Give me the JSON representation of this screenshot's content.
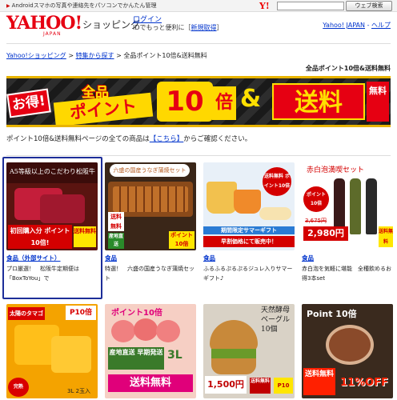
{
  "topbar": {
    "notice": "Androidスマホの写真や連絡先をパソコンでかんたん管理",
    "search_button": "ウェブ検索",
    "search_placeholder": "",
    "y_logo": "Y!"
  },
  "header": {
    "logo": "YAHOO!",
    "logo_sub": "JAPAN",
    "site_name": "ショッピング",
    "login": "ログイン",
    "login_sub": "IDでもっと便利に",
    "register": "新規取得",
    "yahoo_japan_link": "Yahoo! JAPAN",
    "separator": "-",
    "help_link": "ヘルプ"
  },
  "breadcrumb": {
    "items": [
      "Yahoo!ショッピング",
      "特集から探す"
    ],
    "current": "全品ポイント10倍&送料無料",
    "sep": ">"
  },
  "page_title": "全品ポイント10倍&送料無料",
  "banner": {
    "otoku": "お得!",
    "zenpin": "全品",
    "point": "ポイント",
    "ten": "10",
    "bai": "倍",
    "amp": "&",
    "soryo": "送料",
    "muryo": "無料"
  },
  "description": {
    "before": "ポイント10倍&送料無料ページの全ての商品は",
    "link": "【こちら】",
    "after": "からご確認ください。"
  },
  "products": [
    {
      "category": "食品（外部サイト）",
      "title": "プロ厳選！　松阪牛定期便は「BoxToYou」で",
      "img_caption": "A5等級以上のこだわり松阪牛",
      "img_badge": "初回購入分 ポイント10倍!",
      "img_badge2": "送料無料",
      "colors": {
        "bg": "#5a1410",
        "accent": "#c41e3a"
      }
    },
    {
      "category": "食品",
      "title": "特選！　六盛の国産うなぎ蒲焼セット",
      "img_caption": "六盛の国産うなぎ蒲焼セット",
      "img_badge": "産地直送",
      "img_badge2": "送料無料",
      "img_badge3": "ポイント10倍",
      "colors": {
        "bg": "#3a2618",
        "accent": "#b55a1f"
      }
    },
    {
      "category": "食品",
      "title": "ふるふるぷるぷるジュレ入りサマーギフト♪",
      "img_caption": "期間限定サマーギフト",
      "img_badge": "早割価格にて販売中！",
      "img_badge2": "送料無料 ポイント10倍",
      "colors": {
        "bg": "#e8f0f8",
        "accent": "#2a7bd4"
      }
    },
    {
      "category": "食品",
      "title": "赤白泡を気軽に堪能　全種飲めるお得3本set",
      "img_caption": "赤白泡満喫セット",
      "img_badge": "ポイント10倍",
      "img_price_old": "3,675円",
      "img_price": "2,980円",
      "img_badge2": "送料無料",
      "colors": {
        "bg": "#ffffff",
        "accent": "#d40000"
      }
    }
  ],
  "products_row2": [
    {
      "img_caption": "太陽のタマゴ",
      "img_badge": "P10倍",
      "img_badge2": "完熟",
      "img_note": "3L 2玉入",
      "colors": {
        "bg": "#f4a300",
        "accent": "#d80000"
      }
    },
    {
      "img_caption": "ポイント10倍",
      "img_badge": "産地直送 早期発送",
      "img_badge2": "送料無料",
      "img_note": "3L",
      "colors": {
        "bg": "#f6cfc4",
        "accent": "#e0007a"
      }
    },
    {
      "img_caption": "天然酵母ベーグル10個",
      "img_badge": "1,500円",
      "img_badge2": "送料無料",
      "img_badge3": "P10",
      "colors": {
        "bg": "#d9d2c6",
        "accent": "#c00000"
      }
    },
    {
      "img_caption": "Point 10倍",
      "img_badge": "送料無料",
      "img_badge2": "11%OFF",
      "colors": {
        "bg": "#3a2a1e",
        "accent": "#ff2000"
      }
    }
  ]
}
